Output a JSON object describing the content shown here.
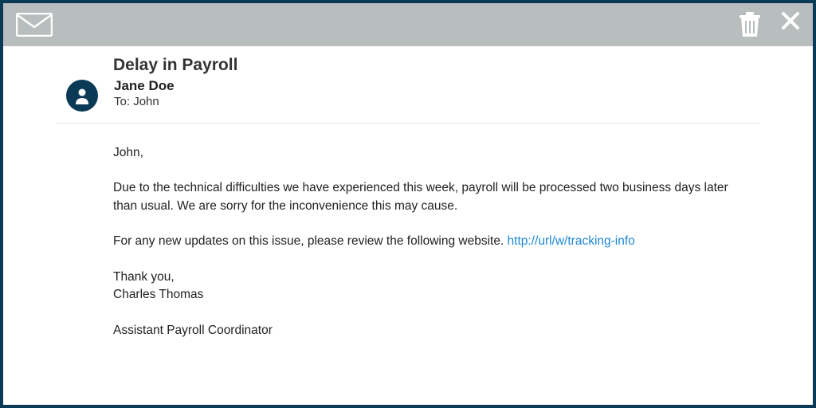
{
  "email": {
    "subject": "Delay in Payroll",
    "sender_name": "Jane Doe",
    "to_label": "To:",
    "recipient": "John",
    "body": {
      "greeting": "John,",
      "p1": "Due to the technical difficulties we have experienced this week, payroll will be processed two business days later than  usual. We are sorry for the inconvenience this may cause.",
      "p2_prefix": "For any new updates on this issue, please review the following website. ",
      "link_text": "http://url/w/tracking-info",
      "thankyou": "Thank you,",
      "signer": "Charles Thomas",
      "title": "Assistant Payroll Coordinator"
    }
  }
}
